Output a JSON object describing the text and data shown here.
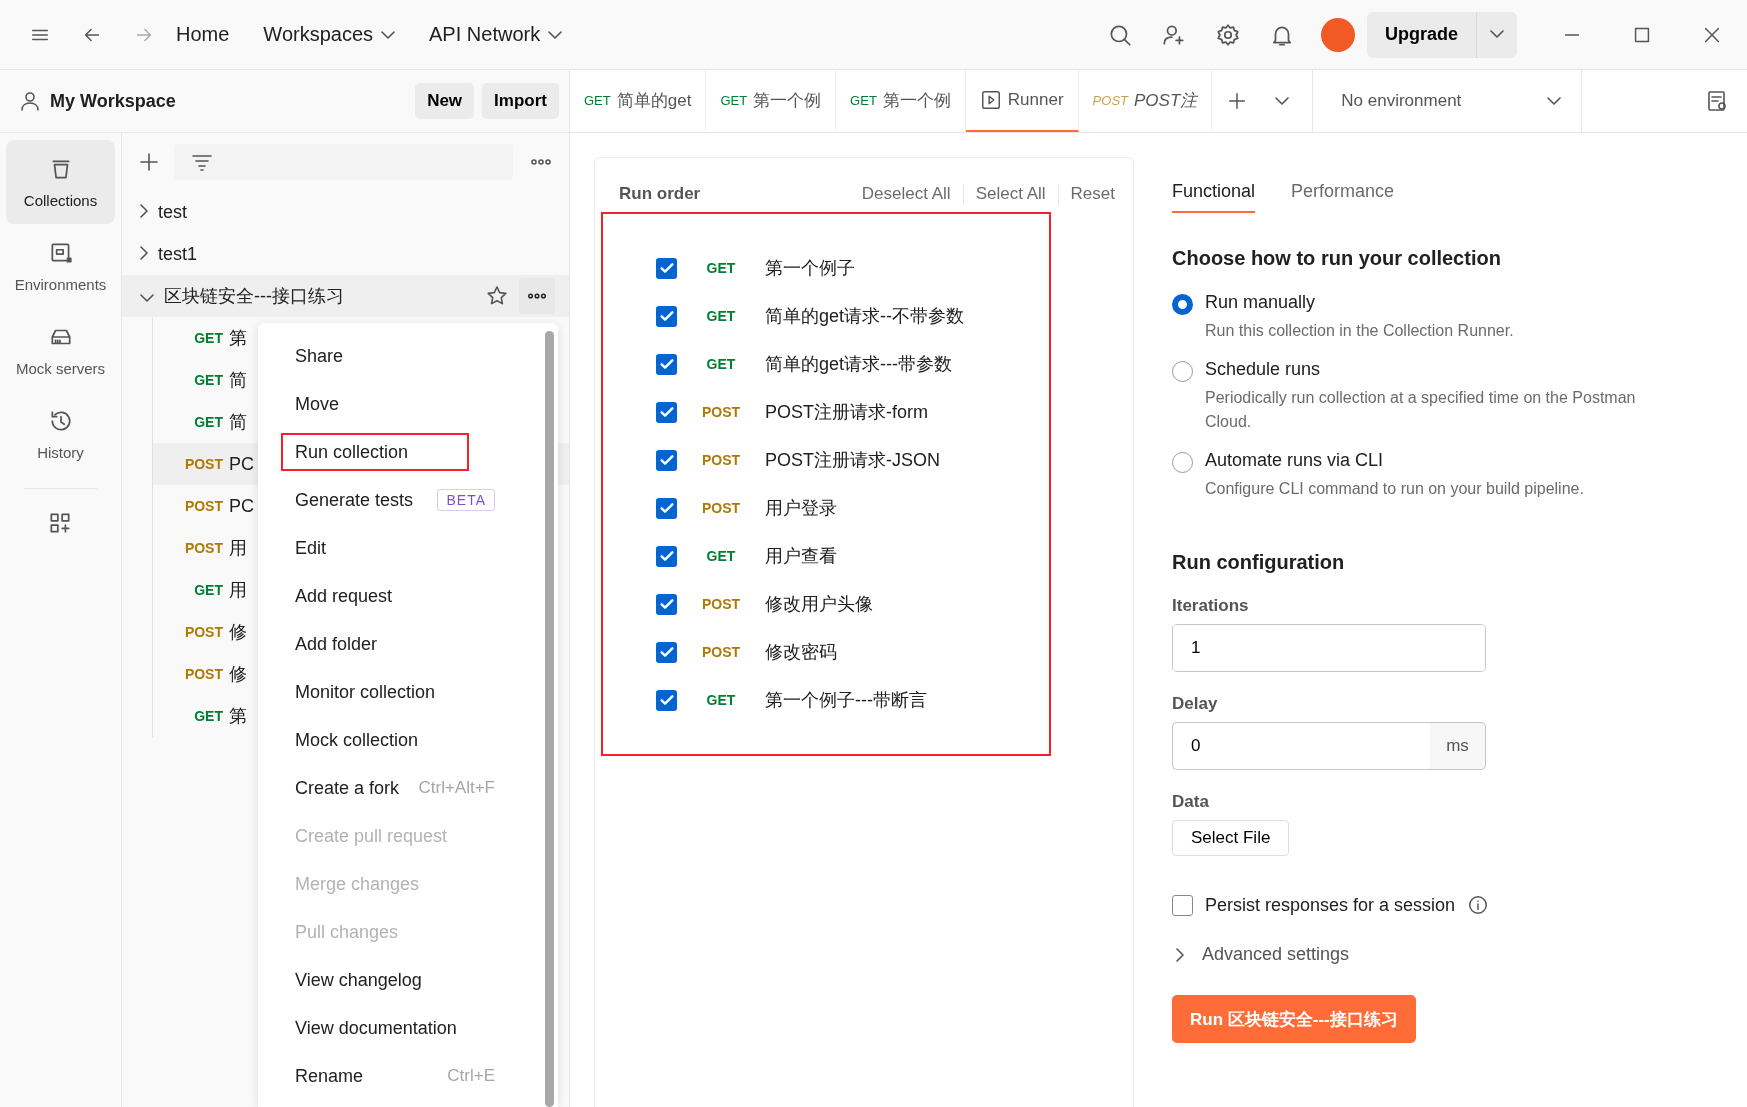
{
  "topbar": {
    "nav": [
      {
        "label": "Home",
        "dropdown": false
      },
      {
        "label": "Workspaces",
        "dropdown": true
      },
      {
        "label": "API Network",
        "dropdown": true
      }
    ],
    "upgrade": "Upgrade"
  },
  "workspace": {
    "name": "My Workspace",
    "buttons": [
      "New",
      "Import"
    ]
  },
  "rail": [
    {
      "label": "Collections",
      "selected": true,
      "kind": "collections"
    },
    {
      "label": "Environments",
      "selected": false,
      "kind": "environments"
    },
    {
      "label": "Mock servers",
      "selected": false,
      "kind": "mock"
    },
    {
      "label": "History",
      "selected": false,
      "kind": "history"
    }
  ],
  "tree": [
    {
      "name": "test",
      "expanded": false,
      "selected": false
    },
    {
      "name": "test1",
      "expanded": false,
      "selected": false
    },
    {
      "name": "区块链安全---接口练习",
      "expanded": true,
      "selected": true,
      "children": [
        {
          "method": "GET",
          "name": "第",
          "selected": false
        },
        {
          "method": "GET",
          "name": "简",
          "selected": false
        },
        {
          "method": "GET",
          "name": "简",
          "selected": false
        },
        {
          "method": "POST",
          "name": "PC",
          "selected": true
        },
        {
          "method": "POST",
          "name": "PC",
          "selected": false
        },
        {
          "method": "POST",
          "name": "用",
          "selected": false
        },
        {
          "method": "GET",
          "name": "用",
          "selected": false
        },
        {
          "method": "POST",
          "name": "修",
          "selected": false
        },
        {
          "method": "POST",
          "name": "修",
          "selected": false
        },
        {
          "method": "GET",
          "name": "第",
          "selected": false
        }
      ]
    }
  ],
  "tabs": [
    {
      "kind": "request",
      "method": "GET",
      "label": "简单的get",
      "selected": false
    },
    {
      "kind": "request",
      "method": "GET",
      "label": "第一个例",
      "selected": false
    },
    {
      "kind": "request",
      "method": "GET",
      "label": "第一个例",
      "selected": false
    },
    {
      "kind": "runner",
      "label": "Runner",
      "selected": true
    },
    {
      "kind": "preview",
      "method": "POST",
      "label": "POST注",
      "selected": false
    }
  ],
  "environment": "No environment",
  "run_order": {
    "title": "Run order",
    "actions": [
      "Deselect All",
      "Select All",
      "Reset"
    ],
    "highlighted": true,
    "items": [
      {
        "method": "GET",
        "name": "第一个例子",
        "checked": true
      },
      {
        "method": "GET",
        "name": "简单的get请求--不带参数",
        "checked": true
      },
      {
        "method": "GET",
        "name": "简单的get请求---带参数",
        "checked": true
      },
      {
        "method": "POST",
        "name": "POST注册请求-form",
        "checked": true
      },
      {
        "method": "POST",
        "name": "POST注册请求-JSON",
        "checked": true
      },
      {
        "method": "POST",
        "name": "用户登录",
        "checked": true
      },
      {
        "method": "GET",
        "name": "用户查看",
        "checked": true
      },
      {
        "method": "POST",
        "name": "修改用户头像",
        "checked": true
      },
      {
        "method": "POST",
        "name": "修改密码",
        "checked": true
      },
      {
        "method": "GET",
        "name": "第一个例子---带断言",
        "checked": true
      }
    ]
  },
  "runner_tabs": [
    {
      "label": "Functional",
      "selected": true
    },
    {
      "label": "Performance",
      "selected": false
    }
  ],
  "run_mode": {
    "heading": "Choose how to run your collection",
    "options": [
      {
        "label": "Run manually",
        "description": "Run this collection in the Collection Runner.",
        "selected": true
      },
      {
        "label": "Schedule runs",
        "description": "Periodically run collection at a specified time on the Postman Cloud.",
        "selected": false
      },
      {
        "label": "Automate runs via CLI",
        "description": "Configure CLI command to run on your build pipeline.",
        "selected": false
      }
    ]
  },
  "config": {
    "heading": "Run configuration",
    "iterations": {
      "label": "Iterations",
      "value": "1"
    },
    "delay": {
      "label": "Delay",
      "value": "0",
      "unit": "ms"
    },
    "data": {
      "label": "Data",
      "button": "Select File"
    },
    "persist": {
      "label": "Persist responses for a session",
      "checked": false
    },
    "advanced": {
      "label": "Advanced settings",
      "expanded": false
    },
    "run_button": "Run 区块链安全---接口练习"
  },
  "context_menu": [
    {
      "label": "Share",
      "disabled": false,
      "highlighted": false
    },
    {
      "label": "Move",
      "disabled": false,
      "highlighted": false
    },
    {
      "label": "Run collection",
      "disabled": false,
      "highlighted": true
    },
    {
      "label": "Generate tests",
      "badge": "BETA",
      "disabled": false,
      "highlighted": false
    },
    {
      "label": "Edit",
      "disabled": false,
      "highlighted": false
    },
    {
      "label": "Add request",
      "disabled": false,
      "highlighted": false
    },
    {
      "label": "Add folder",
      "disabled": false,
      "highlighted": false
    },
    {
      "label": "Monitor collection",
      "disabled": false,
      "highlighted": false
    },
    {
      "label": "Mock collection",
      "disabled": false,
      "highlighted": false
    },
    {
      "label": "Create a fork",
      "shortcut": "Ctrl+Alt+F",
      "disabled": false,
      "highlighted": false
    },
    {
      "label": "Create pull request",
      "disabled": true,
      "highlighted": false
    },
    {
      "label": "Merge changes",
      "disabled": true,
      "highlighted": false
    },
    {
      "label": "Pull changes",
      "disabled": true,
      "highlighted": false
    },
    {
      "label": "View changelog",
      "disabled": false,
      "highlighted": false
    },
    {
      "label": "View documentation",
      "disabled": false,
      "highlighted": false
    },
    {
      "label": "Rename",
      "shortcut": "Ctrl+E",
      "disabled": false,
      "highlighted": false
    }
  ]
}
